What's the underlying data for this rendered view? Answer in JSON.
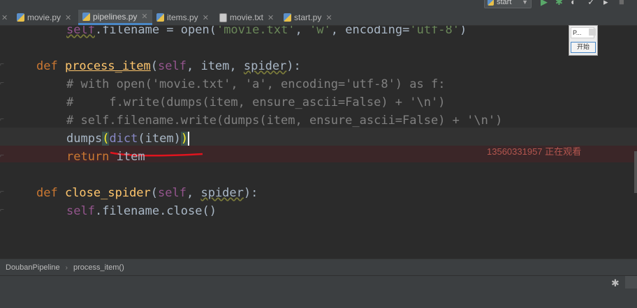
{
  "tabs": [
    {
      "label": "movie.py",
      "icon": "python-file-icon",
      "active": false
    },
    {
      "label": "pipelines.py",
      "icon": "python-file-icon",
      "active": true
    },
    {
      "label": "items.py",
      "icon": "python-file-icon",
      "active": false
    },
    {
      "label": "movie.txt",
      "icon": "text-file-icon",
      "active": false
    },
    {
      "label": "start.py",
      "icon": "python-file-icon",
      "active": false
    }
  ],
  "toolbar": {
    "run_config": "start"
  },
  "code": {
    "l1_prefix": "self",
    "l1_rest": ".filename = open(",
    "l1_str1": "'movie.txt'",
    "l1_comma": ", ",
    "l1_str2": "'w'",
    "l1_enc": ", encoding=",
    "l1_str3": "'utf-8'",
    "l1_end": ")",
    "l2_def": "def ",
    "l2_name": "process_item",
    "l2_open": "(",
    "l2_self": "self",
    "l2_mid": ", item, ",
    "l2_spider": "spider",
    "l2_close": "):",
    "l3": "# with open('movie.txt', 'a', encoding='utf-8') as f:",
    "l4": "#     f.write(dumps(item, ensure_ascii=False) + '\\n')",
    "l5": "# self.filename.write(dumps(item, ensure_ascii=False) + '\\n')",
    "l6_fn": "dumps",
    "l6_open": "(",
    "l6_dict": "dict",
    "l6_mid": "(item)",
    "l6_close": ")",
    "l7_kw": "return",
    "l7_rest": " item",
    "l8_def": "def ",
    "l8_name": "close_spider",
    "l8_open": "(",
    "l8_self": "self",
    "l8_mid": ", ",
    "l8_spider": "spider",
    "l8_close": "):",
    "l9_self": "self",
    "l9_rest": ".filename.close()"
  },
  "overlay": {
    "watch_text": "13560331957 正在观看"
  },
  "mini_window": {
    "title": "P...",
    "button": "开始"
  },
  "breadcrumb": {
    "class_name": "DoubanPipeline",
    "method_name": "process_item()"
  },
  "colors": {
    "keyword": "#cc7832",
    "function": "#ffc66d",
    "self": "#94558d",
    "string": "#6a8759",
    "comment": "#808080",
    "accent": "#4a88c7"
  }
}
